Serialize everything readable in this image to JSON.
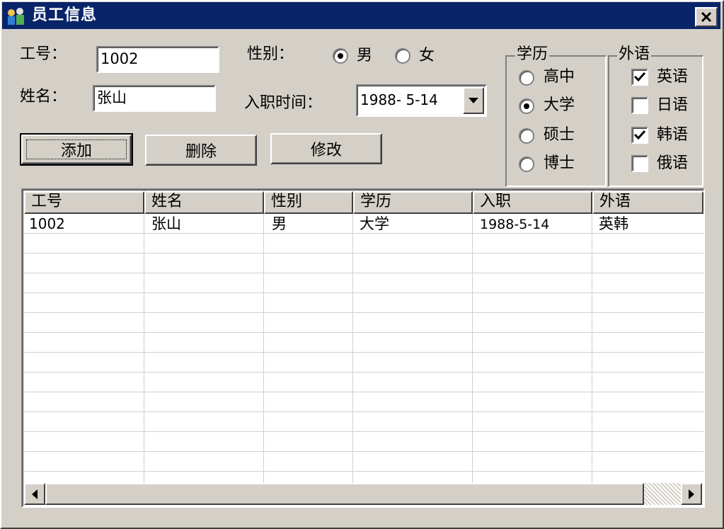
{
  "window": {
    "title": "员工信息"
  },
  "form": {
    "id_label": "工号：",
    "id_value": "1002",
    "name_label": "姓名：",
    "name_value": "张山",
    "gender_label": "性别：",
    "gender_options": [
      {
        "label": "男",
        "selected": true
      },
      {
        "label": "女",
        "selected": false
      }
    ],
    "hire_label": "入职时间：",
    "hire_value": "1988- 5-14"
  },
  "buttons": {
    "add": "添加",
    "delete": "删除",
    "modify": "修改"
  },
  "education": {
    "title": "学历",
    "options": [
      {
        "label": "高中",
        "selected": false
      },
      {
        "label": "大学",
        "selected": true
      },
      {
        "label": "硕士",
        "selected": false
      },
      {
        "label": "博士",
        "selected": false
      }
    ]
  },
  "language": {
    "title": "外语",
    "options": [
      {
        "label": "英语",
        "checked": true
      },
      {
        "label": "日语",
        "checked": false
      },
      {
        "label": "韩语",
        "checked": true
      },
      {
        "label": "俄语",
        "checked": false
      }
    ]
  },
  "table": {
    "columns": [
      "工号",
      "姓名",
      "性别",
      "学历",
      "入职",
      "外语"
    ],
    "rows": [
      [
        "1002",
        "张山",
        "男",
        "大学",
        "1988-5-14",
        "英韩"
      ]
    ]
  }
}
